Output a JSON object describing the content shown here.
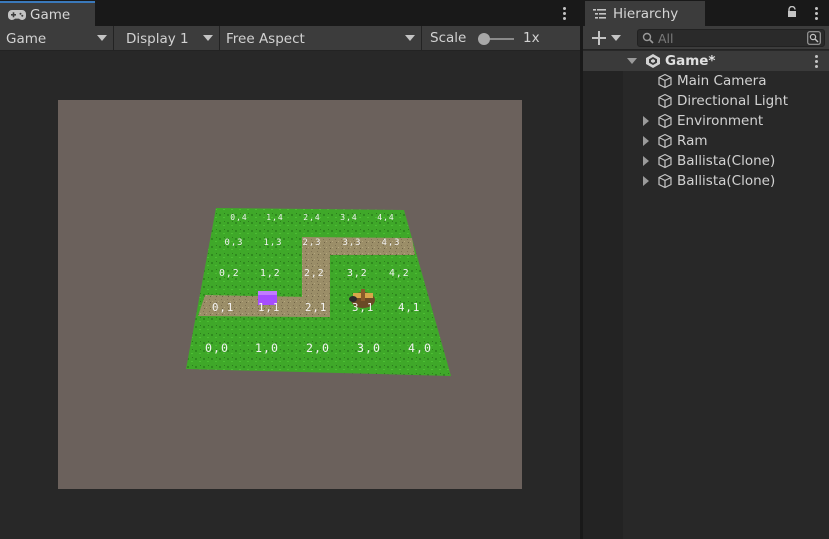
{
  "game": {
    "tab_label": "Game",
    "tab_icon": "gamepad-icon",
    "toolbar": {
      "mode": "Game",
      "display": "Display 1",
      "aspect": "Free Aspect",
      "scale_label": "Scale",
      "scale_value": "1x"
    },
    "viewport": {
      "background": "#6b615c",
      "grid_labels": [
        [
          "0,4",
          "1,4",
          "2,4",
          "3,4",
          "4,4"
        ],
        [
          "0,3",
          "1,3",
          "2,3",
          "3,3",
          "4,3"
        ],
        [
          "0,2",
          "1,2",
          "2,2",
          "3,2",
          "4,2"
        ],
        [
          "0,1",
          "1,1",
          "2,1",
          "3,1",
          "4,1"
        ],
        [
          "0,0",
          "1,0",
          "2,0",
          "3,0",
          "4,0"
        ]
      ]
    }
  },
  "hierarchy": {
    "tab_label": "Hierarchy",
    "search_placeholder": "All",
    "scene": "Game*",
    "items": [
      {
        "label": "Main Camera",
        "expandable": false
      },
      {
        "label": "Directional Light",
        "expandable": false
      },
      {
        "label": "Environment",
        "expandable": true
      },
      {
        "label": "Ram",
        "expandable": true
      },
      {
        "label": "Ballista(Clone)",
        "expandable": true
      },
      {
        "label": "Ballista(Clone)",
        "expandable": true
      }
    ]
  },
  "colors": {
    "accent": "#3a79bb",
    "grass": "#3fa829",
    "path": "#9b8e68"
  }
}
